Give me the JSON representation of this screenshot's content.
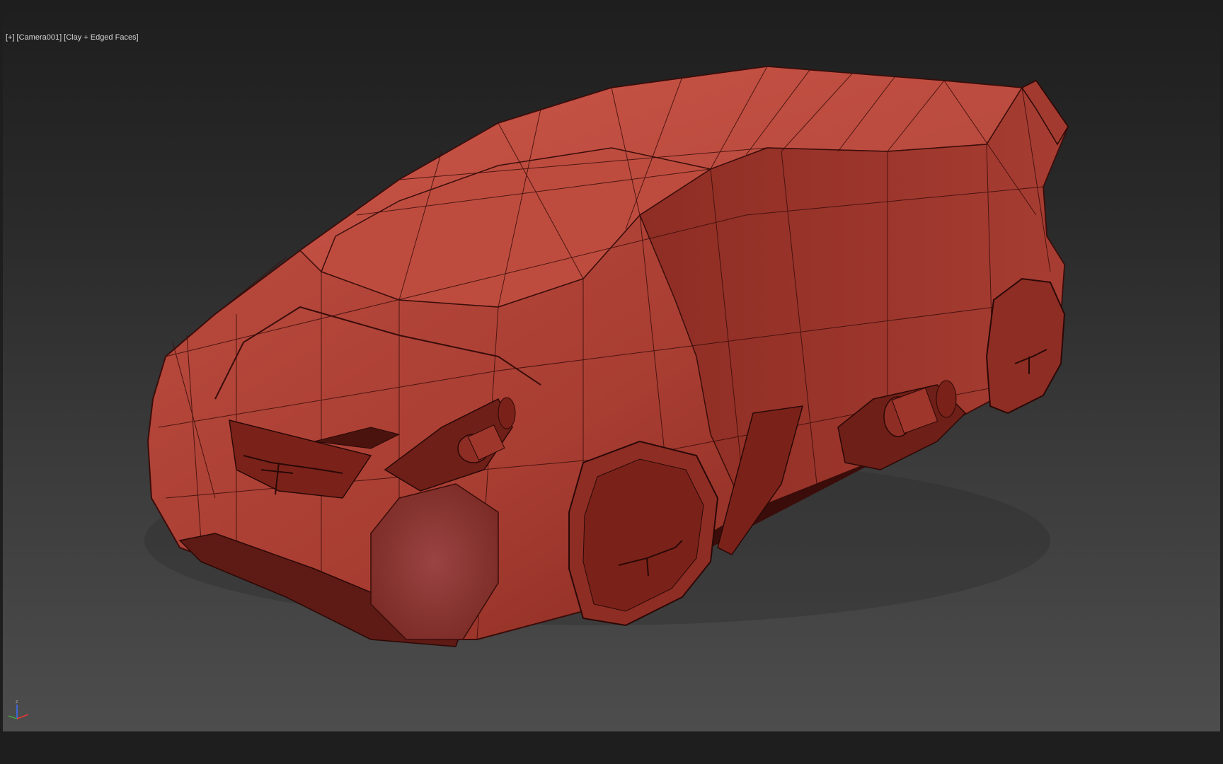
{
  "viewport": {
    "label_plus": "[+]",
    "label_camera": "[Camera001]",
    "label_shading": "[Clay + Edged Faces]"
  },
  "scene": {
    "object": "car-model",
    "material_color": "#b84a3e",
    "shadow_color": "#5e1a14",
    "wire_color": "#3a0d0a"
  },
  "gizmo": {
    "z_label": "z",
    "x_color": "#e53935",
    "y_color": "#43a047",
    "z_color": "#3d6fff"
  },
  "colors": {
    "background_top": "#1e1e1e",
    "background_bottom": "#4d4d4d",
    "label_text": "#d6d6d6"
  }
}
